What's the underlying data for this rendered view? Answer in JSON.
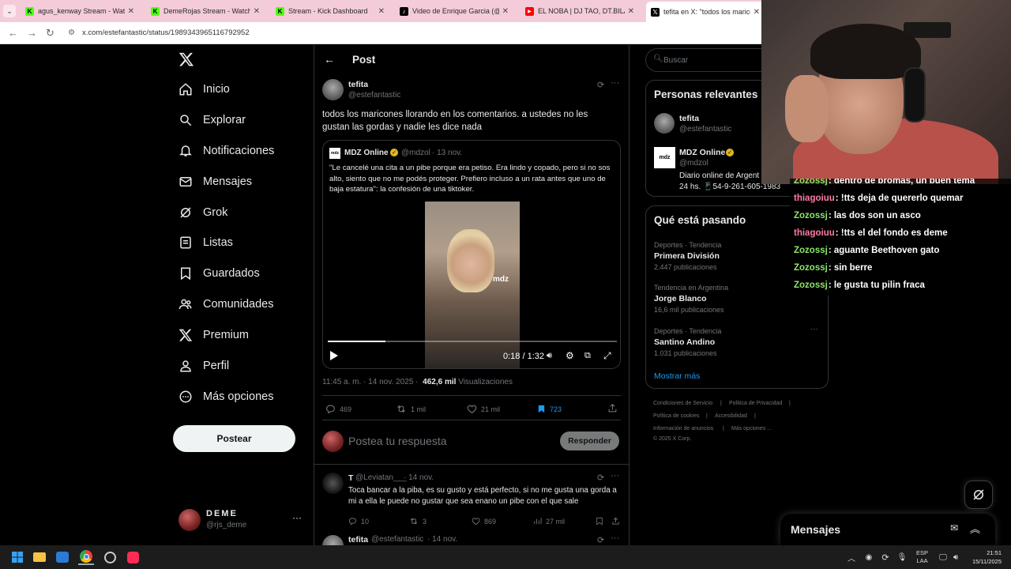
{
  "browser": {
    "tabs": [
      {
        "title": "agus_kenway Stream - Watch Li",
        "icon": "kick-icon",
        "color": "#53fc18"
      },
      {
        "title": "DemeRojas Stream - Watch Live",
        "icon": "kick-icon",
        "color": "#53fc18"
      },
      {
        "title": "Stream - Kick Dashboard",
        "icon": "kick-icon",
        "color": "#53fc18"
      },
      {
        "title": "Video de Enrique Garcia (@psu",
        "icon": "tiktok-icon",
        "color": "#000000"
      },
      {
        "title": "EL NOBA | DJ TAO, DT.BILARDO",
        "icon": "youtube-icon",
        "color": "#ff0000"
      },
      {
        "title": "tefita en X: \"todos los marico",
        "icon": "x-icon",
        "color": "#000000"
      }
    ],
    "url": "x.com/estefantastic/status/1989343965116792952"
  },
  "nav": {
    "logo": "X",
    "items": [
      {
        "label": "Inicio",
        "icon": "home-icon"
      },
      {
        "label": "Explorar",
        "icon": "search-icon"
      },
      {
        "label": "Notificaciones",
        "icon": "bell-icon"
      },
      {
        "label": "Mensajes",
        "icon": "mail-icon"
      },
      {
        "label": "Grok",
        "icon": "grok-icon"
      },
      {
        "label": "Listas",
        "icon": "list-icon"
      },
      {
        "label": "Guardados",
        "icon": "bookmark-icon"
      },
      {
        "label": "Comunidades",
        "icon": "people-icon"
      },
      {
        "label": "Premium",
        "icon": "x-icon"
      },
      {
        "label": "Perfil",
        "icon": "person-icon"
      },
      {
        "label": "Más opciones",
        "icon": "more-circle-icon"
      }
    ],
    "post_button": "Postear",
    "account": {
      "name": "DEME",
      "handle": "@rjs_deme"
    }
  },
  "post": {
    "header": "Post",
    "author": "tefita",
    "handle": "@estefantastic",
    "text": "todos los maricones llorando en los comentarios. a ustedes no les gustan las gordas y nadie les dice nada",
    "quote": {
      "author": "MDZ Online",
      "handle": "@mdzol",
      "date": "· 13 nov.",
      "text": "\"Le cancelé una cita a un pibe porque era petiso. Era lindo y copado, pero si no sos alto, siento que no me podés proteger. Prefiero incluso a un rata antes que uno de baja estatura\": la confesión de una tiktoker.",
      "video_time": "0:18 / 1:32",
      "video_progress": 0.2,
      "watermark": "mdz"
    },
    "timestamp": "11:45 a. m. · 14 nov. 2025 ·",
    "views": "462,6 mil",
    "views_label": "Visualizaciones",
    "stats": {
      "replies": "469",
      "reposts": "1 mil",
      "likes": "21 mil",
      "bookmarks": "723"
    },
    "reply_placeholder": "Postea tu respuesta",
    "reply_button": "Responder"
  },
  "replies": [
    {
      "author": "T",
      "handle": "@Leviatan___",
      "date": "· 14 nov.",
      "text": "Toca bancar a la piba, es su gusto y está perfecto, si no me gusta una gorda a mi a ella le puede no gustar que sea enano un pibe con el que sale",
      "stats": {
        "replies": "10",
        "reposts": "3",
        "likes": "869",
        "views": "27 mil"
      }
    },
    {
      "author": "tefita",
      "handle": "@estefantastic",
      "date": "· 14 nov."
    }
  ],
  "sidebar": {
    "search_placeholder": "Buscar",
    "relevant_title": "Personas relevantes",
    "people": [
      {
        "name": "tefita",
        "handle": "@estefantastic"
      },
      {
        "name": "MDZ Online",
        "handle": "@mdzol",
        "bio_line1": "Diario online de Argent",
        "bio_line2": "24 hs. 📱54-9-261-605-1983"
      }
    ],
    "trends_title": "Qué está pasando",
    "trends": [
      {
        "category": "Deportes · Tendencia",
        "name": "Primera División",
        "count": "2.447 publicaciones"
      },
      {
        "category": "Tendencia en Argentina",
        "name": "Jorge Blanco",
        "count": "16,6 mil publicaciones"
      },
      {
        "category": "Deportes · Tendencia",
        "name": "Santino Andino",
        "count": "1.031 publicaciones"
      }
    ],
    "show_more": "Mostrar más",
    "footer": [
      "Condiciones de Servicio",
      "Política de Privacidad",
      "Política de cookies",
      "Accesibilidad",
      "Información de anuncios",
      "Más opciones ...",
      "© 2025 X Corp."
    ],
    "messages_title": "Mensajes"
  },
  "chat": {
    "messages": [
      {
        "user": "Zozossj",
        "text": ": dentro de bromas, un buen tema",
        "color": "#8fe66a"
      },
      {
        "user": "thiagoiuu",
        "text": ": !tts deja de quererlo quemar",
        "color": "#ff7aa8"
      },
      {
        "user": "Zozossj",
        "text": ": las dos son un asco",
        "color": "#8fe66a"
      },
      {
        "user": "thiagoiuu",
        "text": ": !tts el del fondo es deme",
        "color": "#ff7aa8"
      },
      {
        "user": "Zozossj",
        "text": ": aguante Beethoven gato",
        "color": "#8fe66a"
      },
      {
        "user": "Zozossj",
        "text": ": sin berre",
        "color": "#8fe66a"
      },
      {
        "user": "Zozossj",
        "text": ": le gusta tu pilin fraca",
        "color": "#8fe66a"
      }
    ]
  },
  "taskbar": {
    "lang": "ESP",
    "lang2": "LAA",
    "time": "21:51",
    "date": "15/11/2025"
  },
  "colors": {
    "accent": "#1d9bf0",
    "verified": "#e2b719",
    "tabbar": "#f4ccd9"
  }
}
